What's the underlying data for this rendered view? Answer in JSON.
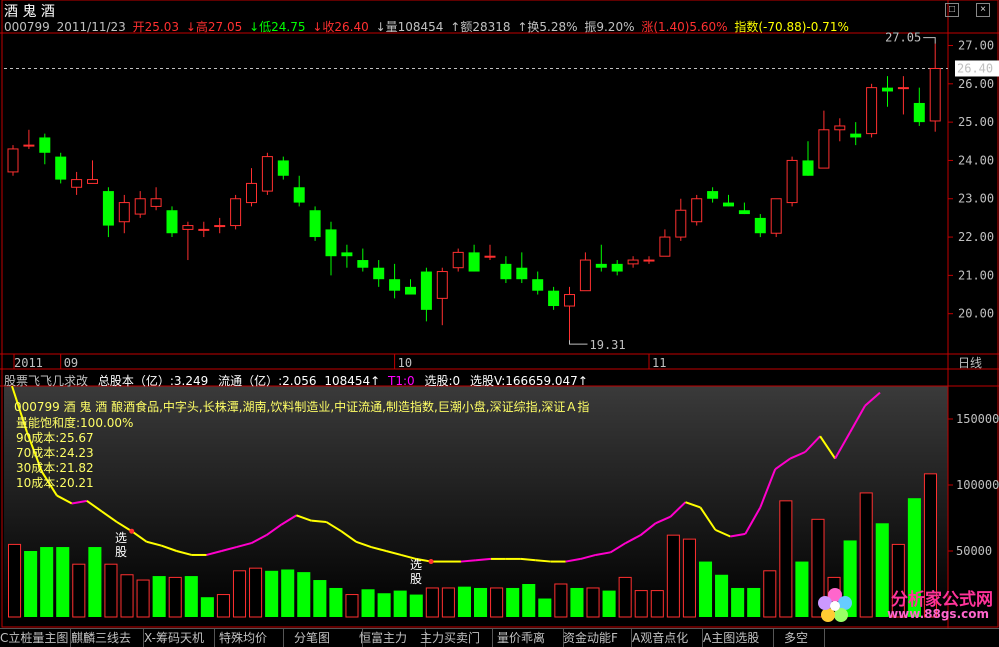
{
  "stock": {
    "name": "酒 鬼 酒",
    "code": "000799",
    "date": "2011/11/23",
    "open_label": "开25.03",
    "high_label": "↓高27.05",
    "low_label": "↓低24.75",
    "close_label": "↓收26.40",
    "volume_label": "↓量108454",
    "amount_label": "↑额28318",
    "turnover_label": "↑换5.28%",
    "amplitude_label": "振9.20%",
    "change_label": "涨(1.40)5.60%",
    "index_label": "指数(-70.88)-0.71%"
  },
  "window_buttons": {
    "restore": "□",
    "close": "×"
  },
  "price_axis": {
    "labels": [
      "27.00",
      "26.00",
      "25.00",
      "24.00",
      "23.00",
      "22.00",
      "21.00",
      "20.00"
    ],
    "current_price": "26.40"
  },
  "annotations": {
    "high": "27.05",
    "low": "19.31"
  },
  "time_axis": {
    "year": "2011",
    "months": [
      "09",
      "10",
      "11"
    ],
    "period": "日线"
  },
  "indicator_header": {
    "title": "股票飞飞几求改",
    "total_shares": "总股本（亿）:3.249",
    "float_shares": "流通（亿）:2.056",
    "volume": "108454↑",
    "t1": "T1:0",
    "select": "选股:0",
    "select_v": "选股V:166659.047↑"
  },
  "indicator_info": {
    "line1": "000799 酒 鬼 酒 酿酒食品,中字头,长株潭,湖南,饮料制造业,中证流通,制造指数,巨潮小盘,深证综指,深证Ａ指",
    "line2": "量能饱和度:100.00%",
    "line3": "90成本:25.67",
    "line4": "70成本:24.23",
    "line5": "30成本:21.82",
    "line6": "10成本:20.21"
  },
  "signals": {
    "label1": "选股",
    "label2": "选股"
  },
  "volume_axis": {
    "labels": [
      "150000",
      "100000",
      "50000"
    ]
  },
  "tabs": [
    "C立桩量主图",
    "麒麟三线去",
    "X-筹码天机",
    "特殊均价",
    "分笔图",
    "恒富主力",
    "主力买卖门",
    "量价乖离",
    "资金动能F",
    "A观音点化",
    "A主图选股",
    "多空"
  ],
  "logo": {
    "title": "分析家公式网",
    "url": "www.88gs.com"
  },
  "colors": {
    "up": "#ff3030",
    "down": "#00ff00",
    "line_yellow": "#ffff00",
    "line_magenta": "#ff00cc",
    "info_red": "#ff3030",
    "info_green": "#00ff00"
  },
  "chart_data": [
    {
      "type": "candlestick",
      "title": "酒 鬼 酒 日线",
      "ylim": [
        19.0,
        27.3
      ],
      "candles": [
        {
          "o": 23.7,
          "h": 24.4,
          "l": 23.6,
          "c": 24.3
        },
        {
          "o": 24.4,
          "h": 24.8,
          "l": 24.3,
          "c": 24.4
        },
        {
          "o": 24.6,
          "h": 24.7,
          "l": 23.9,
          "c": 24.2
        },
        {
          "o": 24.1,
          "h": 24.2,
          "l": 23.4,
          "c": 23.5
        },
        {
          "o": 23.3,
          "h": 23.7,
          "l": 23.1,
          "c": 23.5
        },
        {
          "o": 23.4,
          "h": 24.0,
          "l": 23.4,
          "c": 23.5
        },
        {
          "o": 23.2,
          "h": 23.3,
          "l": 22.0,
          "c": 22.3
        },
        {
          "o": 22.4,
          "h": 23.1,
          "l": 22.1,
          "c": 22.9
        },
        {
          "o": 22.6,
          "h": 23.2,
          "l": 22.5,
          "c": 23.0
        },
        {
          "o": 22.8,
          "h": 23.3,
          "l": 22.7,
          "c": 23.0
        },
        {
          "o": 22.7,
          "h": 22.8,
          "l": 22.0,
          "c": 22.1
        },
        {
          "o": 22.2,
          "h": 22.4,
          "l": 21.4,
          "c": 22.3
        },
        {
          "o": 22.2,
          "h": 22.4,
          "l": 22.0,
          "c": 22.2
        },
        {
          "o": 22.3,
          "h": 22.5,
          "l": 22.1,
          "c": 22.3
        },
        {
          "o": 22.3,
          "h": 23.1,
          "l": 22.2,
          "c": 23.0
        },
        {
          "o": 22.9,
          "h": 23.8,
          "l": 22.8,
          "c": 23.4
        },
        {
          "o": 23.2,
          "h": 24.2,
          "l": 23.1,
          "c": 24.1
        },
        {
          "o": 24.0,
          "h": 24.1,
          "l": 23.5,
          "c": 23.6
        },
        {
          "o": 23.3,
          "h": 23.6,
          "l": 22.8,
          "c": 22.9
        },
        {
          "o": 22.7,
          "h": 22.8,
          "l": 21.9,
          "c": 22.0
        },
        {
          "o": 22.2,
          "h": 22.4,
          "l": 21.0,
          "c": 21.5
        },
        {
          "o": 21.6,
          "h": 21.8,
          "l": 21.2,
          "c": 21.5
        },
        {
          "o": 21.4,
          "h": 21.7,
          "l": 21.1,
          "c": 21.2
        },
        {
          "o": 21.2,
          "h": 21.4,
          "l": 20.7,
          "c": 20.9
        },
        {
          "o": 20.9,
          "h": 21.3,
          "l": 20.4,
          "c": 20.6
        },
        {
          "o": 20.7,
          "h": 20.9,
          "l": 20.5,
          "c": 20.5
        },
        {
          "o": 21.1,
          "h": 21.2,
          "l": 19.8,
          "c": 20.1
        },
        {
          "o": 20.4,
          "h": 21.2,
          "l": 19.7,
          "c": 21.1
        },
        {
          "o": 21.2,
          "h": 21.7,
          "l": 21.1,
          "c": 21.6
        },
        {
          "o": 21.6,
          "h": 21.8,
          "l": 21.1,
          "c": 21.1
        },
        {
          "o": 21.5,
          "h": 21.8,
          "l": 21.4,
          "c": 21.5
        },
        {
          "o": 21.3,
          "h": 21.5,
          "l": 20.8,
          "c": 20.9
        },
        {
          "o": 21.2,
          "h": 21.6,
          "l": 20.8,
          "c": 20.9
        },
        {
          "o": 20.9,
          "h": 21.1,
          "l": 20.5,
          "c": 20.6
        },
        {
          "o": 20.6,
          "h": 20.7,
          "l": 20.1,
          "c": 20.2
        },
        {
          "o": 20.2,
          "h": 20.7,
          "l": 19.31,
          "c": 20.5
        },
        {
          "o": 20.6,
          "h": 21.6,
          "l": 20.6,
          "c": 21.4
        },
        {
          "o": 21.3,
          "h": 21.8,
          "l": 21.1,
          "c": 21.2
        },
        {
          "o": 21.3,
          "h": 21.4,
          "l": 21.0,
          "c": 21.1
        },
        {
          "o": 21.3,
          "h": 21.5,
          "l": 21.2,
          "c": 21.4
        },
        {
          "o": 21.4,
          "h": 21.5,
          "l": 21.3,
          "c": 21.4
        },
        {
          "o": 21.5,
          "h": 22.2,
          "l": 21.5,
          "c": 22.0
        },
        {
          "o": 22.0,
          "h": 23.0,
          "l": 21.9,
          "c": 22.7
        },
        {
          "o": 22.4,
          "h": 23.1,
          "l": 22.3,
          "c": 23.0
        },
        {
          "o": 23.2,
          "h": 23.3,
          "l": 22.9,
          "c": 23.0
        },
        {
          "o": 22.9,
          "h": 23.1,
          "l": 22.8,
          "c": 22.8
        },
        {
          "o": 22.7,
          "h": 22.9,
          "l": 22.6,
          "c": 22.6
        },
        {
          "o": 22.5,
          "h": 22.6,
          "l": 22.0,
          "c": 22.1
        },
        {
          "o": 22.1,
          "h": 23.0,
          "l": 22.0,
          "c": 23.0
        },
        {
          "o": 22.9,
          "h": 24.1,
          "l": 22.8,
          "c": 24.0
        },
        {
          "o": 24.0,
          "h": 24.5,
          "l": 23.6,
          "c": 23.6
        },
        {
          "o": 23.8,
          "h": 25.3,
          "l": 23.8,
          "c": 24.8
        },
        {
          "o": 24.8,
          "h": 25.1,
          "l": 24.5,
          "c": 24.9
        },
        {
          "o": 24.7,
          "h": 25.0,
          "l": 24.4,
          "c": 24.6
        },
        {
          "o": 24.7,
          "h": 26.0,
          "l": 24.6,
          "c": 25.9
        },
        {
          "o": 25.9,
          "h": 26.2,
          "l": 25.4,
          "c": 25.8
        },
        {
          "o": 25.9,
          "h": 26.2,
          "l": 25.2,
          "c": 25.9
        },
        {
          "o": 25.5,
          "h": 25.9,
          "l": 24.9,
          "c": 25.0
        },
        {
          "o": 25.03,
          "h": 27.05,
          "l": 24.75,
          "c": 26.4
        }
      ]
    },
    {
      "type": "bar",
      "title": "成交量",
      "ylim": [
        0,
        175000
      ],
      "volumes": [
        {
          "v": 55000,
          "up": true
        },
        {
          "v": 50000,
          "up": false
        },
        {
          "v": 53000,
          "up": false
        },
        {
          "v": 53000,
          "up": false
        },
        {
          "v": 40000,
          "up": true
        },
        {
          "v": 53000,
          "up": false
        },
        {
          "v": 40000,
          "up": true
        },
        {
          "v": 32000,
          "up": true
        },
        {
          "v": 28000,
          "up": true
        },
        {
          "v": 31000,
          "up": false
        },
        {
          "v": 30000,
          "up": true
        },
        {
          "v": 31000,
          "up": false
        },
        {
          "v": 15000,
          "up": false
        },
        {
          "v": 17000,
          "up": true
        },
        {
          "v": 35000,
          "up": true
        },
        {
          "v": 37000,
          "up": true
        },
        {
          "v": 35000,
          "up": false
        },
        {
          "v": 36000,
          "up": false
        },
        {
          "v": 34000,
          "up": false
        },
        {
          "v": 28000,
          "up": false
        },
        {
          "v": 22000,
          "up": false
        },
        {
          "v": 17000,
          "up": true
        },
        {
          "v": 21000,
          "up": false
        },
        {
          "v": 18000,
          "up": false
        },
        {
          "v": 20000,
          "up": false
        },
        {
          "v": 17000,
          "up": false
        },
        {
          "v": 22000,
          "up": true
        },
        {
          "v": 22000,
          "up": true
        },
        {
          "v": 23000,
          "up": false
        },
        {
          "v": 22000,
          "up": false
        },
        {
          "v": 22000,
          "up": true
        },
        {
          "v": 22000,
          "up": false
        },
        {
          "v": 25000,
          "up": false
        },
        {
          "v": 14000,
          "up": false
        },
        {
          "v": 25000,
          "up": true
        },
        {
          "v": 22000,
          "up": false
        },
        {
          "v": 22000,
          "up": true
        },
        {
          "v": 20000,
          "up": false
        },
        {
          "v": 30000,
          "up": true
        },
        {
          "v": 20000,
          "up": true
        },
        {
          "v": 20000,
          "up": true
        },
        {
          "v": 62000,
          "up": true
        },
        {
          "v": 59000,
          "up": true
        },
        {
          "v": 42000,
          "up": false
        },
        {
          "v": 32000,
          "up": false
        },
        {
          "v": 22000,
          "up": false
        },
        {
          "v": 22000,
          "up": false
        },
        {
          "v": 35000,
          "up": true
        },
        {
          "v": 88000,
          "up": true
        },
        {
          "v": 42000,
          "up": false
        },
        {
          "v": 74000,
          "up": true
        },
        {
          "v": 30000,
          "up": true
        },
        {
          "v": 58000,
          "up": false
        },
        {
          "v": 94000,
          "up": true
        },
        {
          "v": 71000,
          "up": false
        },
        {
          "v": 55000,
          "up": true
        },
        {
          "v": 90000,
          "up": false
        },
        {
          "v": 108454,
          "up": true
        }
      ],
      "line": [
        175000,
        140000,
        110000,
        92000,
        86000,
        88000,
        80000,
        72000,
        65000,
        57000,
        54000,
        50000,
        47000,
        47000,
        50000,
        53000,
        56000,
        62000,
        70000,
        77000,
        73000,
        72000,
        65000,
        57000,
        53000,
        50000,
        47000,
        44000,
        42000,
        42000,
        42000,
        43000,
        44000,
        44000,
        44000,
        43000,
        42000,
        42000,
        44000,
        47000,
        49000,
        56000,
        62000,
        71000,
        76000,
        87000,
        83000,
        66000,
        61000,
        63000,
        83000,
        112000,
        120000,
        125000,
        137000,
        120000,
        140000,
        160000,
        170000
      ]
    }
  ]
}
